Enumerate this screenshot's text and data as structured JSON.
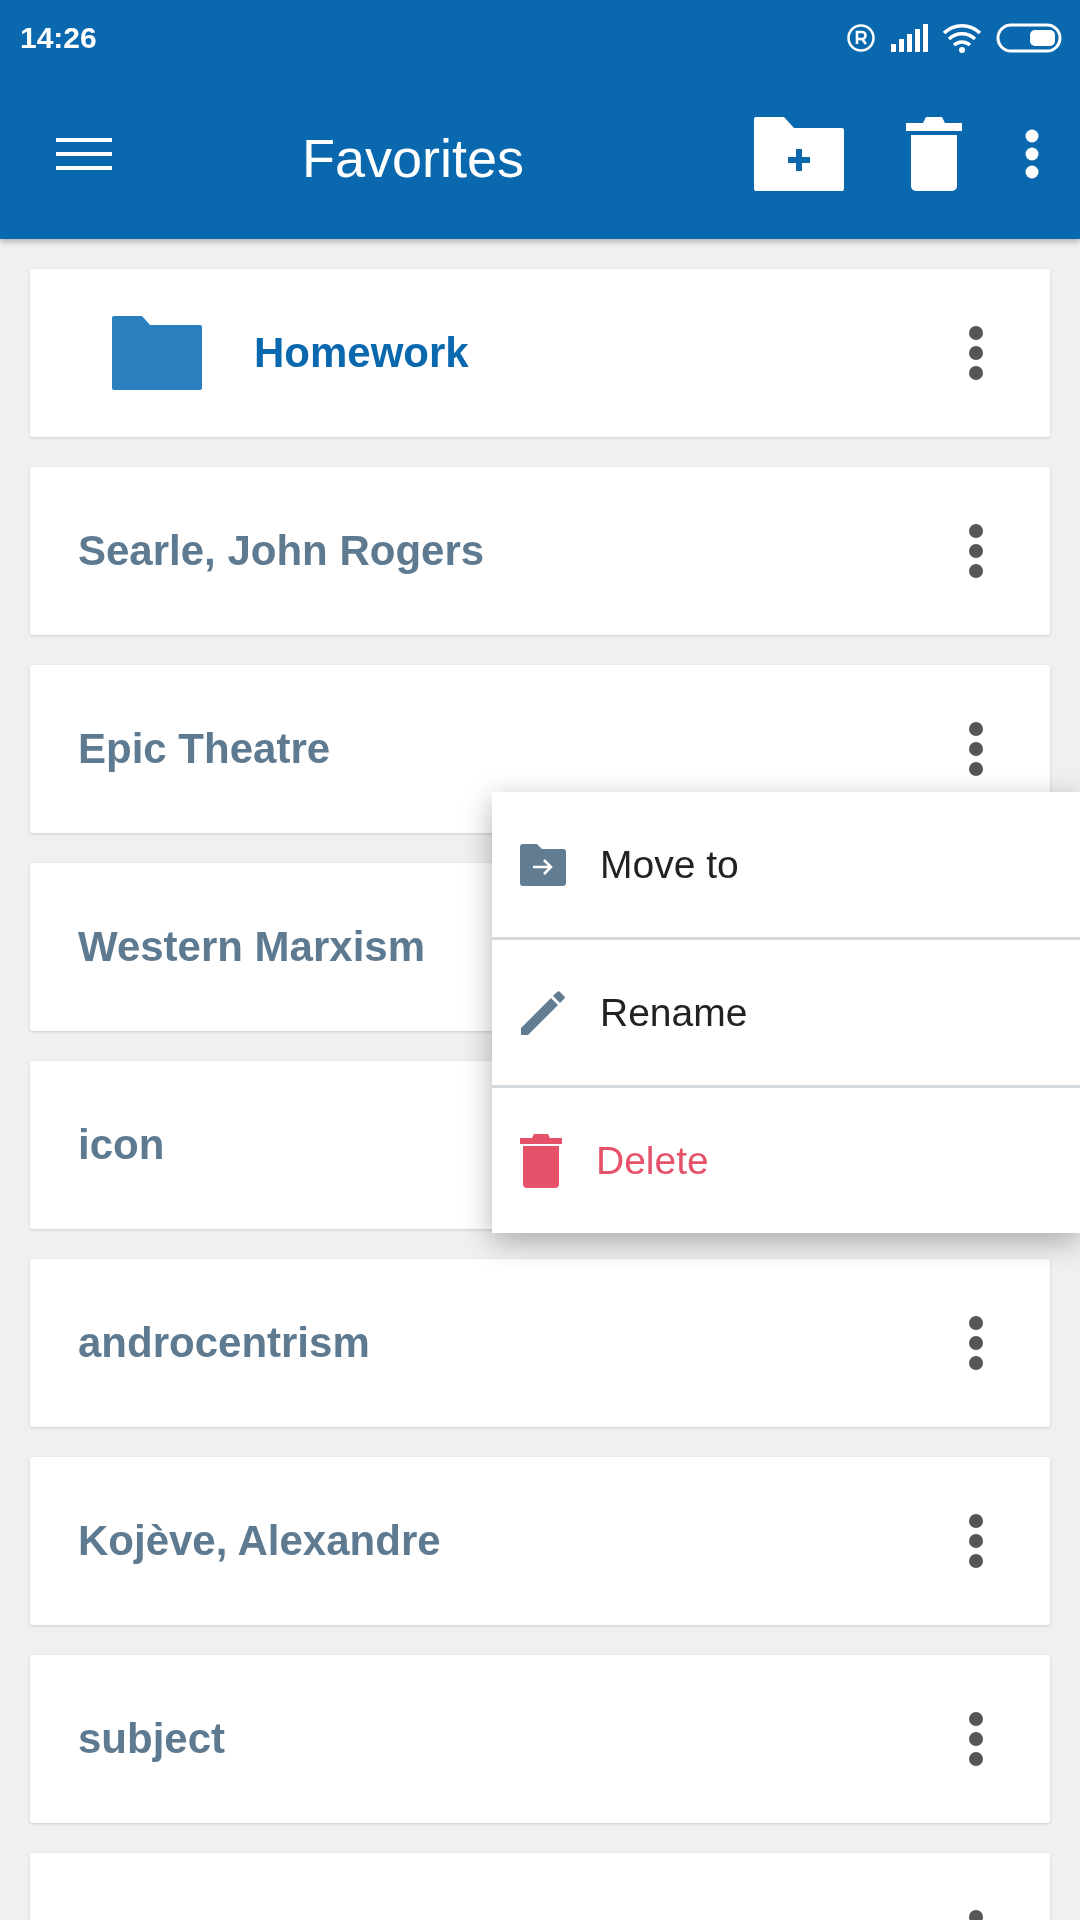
{
  "status_bar": {
    "time": "14:26"
  },
  "app_bar": {
    "title": "Favorites"
  },
  "items": [
    {
      "kind": "folder",
      "title": "Homework",
      "menu_button": true
    },
    {
      "kind": "entry",
      "title": "Searle, John Rogers",
      "menu_button": true
    },
    {
      "kind": "entry",
      "title": "Epic Theatre",
      "menu_button": true
    },
    {
      "kind": "entry",
      "title": "Western Marxism",
      "menu_button": false
    },
    {
      "kind": "entry",
      "title": "icon",
      "menu_button": false
    },
    {
      "kind": "entry",
      "title": "androcentrism",
      "menu_button": true
    },
    {
      "kind": "entry",
      "title": "Kojève, Alexandre",
      "menu_button": true
    },
    {
      "kind": "entry",
      "title": "subject",
      "menu_button": true
    },
    {
      "kind": "entry",
      "menu_button": true
    }
  ],
  "context_menu": [
    {
      "kind": "move",
      "label": "Move to"
    },
    {
      "kind": "rename",
      "label": "Rename"
    },
    {
      "kind": "delete",
      "label": "Delete"
    }
  ]
}
